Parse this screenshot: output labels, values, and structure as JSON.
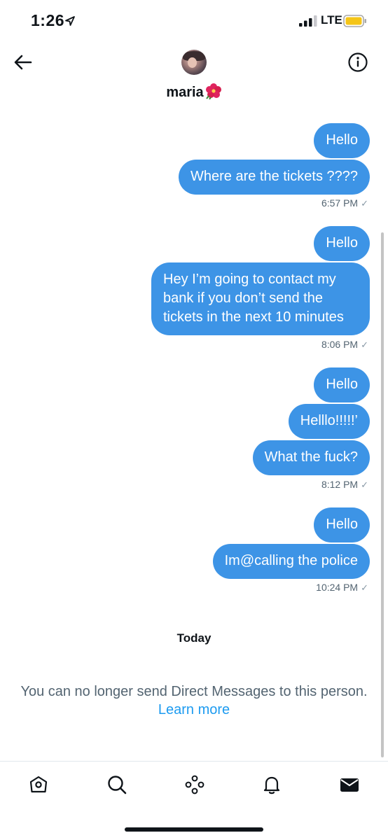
{
  "status_bar": {
    "time": "1:26",
    "network": "LTE",
    "icons": [
      "location-arrow-icon",
      "signal-bars-icon",
      "battery-icon"
    ],
    "battery_color": "#f5c518"
  },
  "header": {
    "contact_name": "maria",
    "icons": [
      "back-arrow-icon",
      "avatar",
      "hibiscus-icon",
      "info-icon"
    ]
  },
  "accent_color": "#3d94e6",
  "messages": [
    {
      "text": "Hello"
    },
    {
      "text": "Where are the tickets ????"
    },
    {
      "text": "Hello"
    },
    {
      "text": "Hey I’m going to contact my bank if you don’t send the tickets in the next 10 minutes"
    },
    {
      "text": "Hello"
    },
    {
      "text": "Helllo!!!!!’"
    },
    {
      "text": "What the fuck?"
    },
    {
      "text": "Hello"
    },
    {
      "text": "Im@calling the police"
    }
  ],
  "timestamps": [
    "6:57 PM",
    "8:06 PM",
    "8:12 PM",
    "10:24 PM"
  ],
  "check_mark": "✓",
  "day_label": "Today",
  "notice": {
    "text": "You can no longer send Direct Messages to this person.",
    "link": "Learn more"
  },
  "bottom_nav": [
    "home-icon",
    "search-icon",
    "spaces-icon",
    "notifications-bell-icon",
    "messages-envelope-icon"
  ]
}
